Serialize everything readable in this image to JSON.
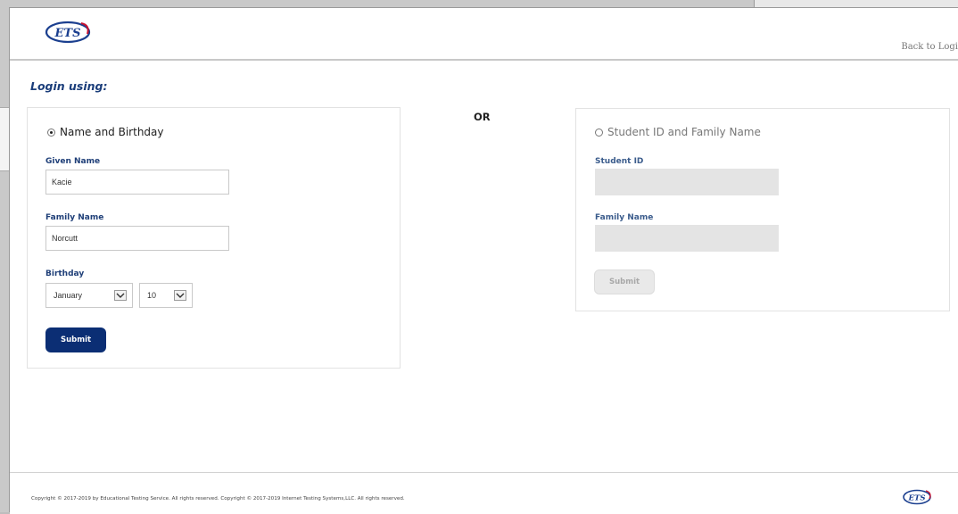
{
  "header": {
    "logo_text": "ETS",
    "back_link": "Back to Logi"
  },
  "login_title": "Login using:",
  "or_text": "OR",
  "left_panel": {
    "option_label": "Name and Birthday",
    "given_name_label": "Given Name",
    "given_name_value": "Kacie",
    "family_name_label": "Family Name",
    "family_name_value": "Norcutt",
    "birthday_label": "Birthday",
    "month_value": "January",
    "day_value": "10",
    "submit_label": "Submit"
  },
  "right_panel": {
    "option_label": "Student ID and Family Name",
    "student_id_label": "Student ID",
    "family_name_label": "Family Name",
    "submit_label": "Submit"
  },
  "footer": {
    "copyright": "Copyright © 2017-2019 by Educational Testing Service. All rights reserved. Copyright © 2017-2019 Internet Testing Systems,LLC. All rights reserved.",
    "logo_text": "ETS"
  },
  "colors": {
    "primary_button": "#0b2e74",
    "label_blue": "#1f3f78",
    "logo_blue": "#1b3f8f",
    "logo_red": "#c8102e"
  }
}
